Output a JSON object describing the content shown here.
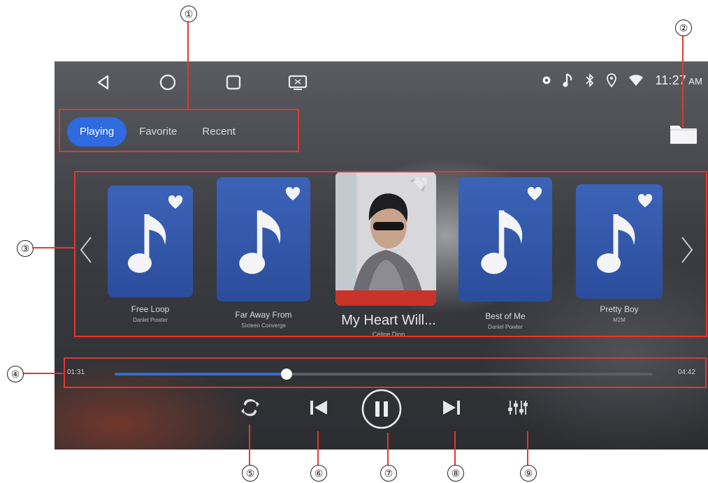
{
  "status_bar": {
    "nav_icons": [
      "back-icon",
      "home-icon",
      "recents-icon",
      "screen-icon"
    ],
    "status_icons": [
      "settings-dot-icon",
      "music-note-icon",
      "bluetooth-icon",
      "location-icon",
      "wifi-icon"
    ],
    "time": "11:27",
    "ampm": "AM"
  },
  "tabs": [
    {
      "label": "Playing",
      "active": true
    },
    {
      "label": "Favorite",
      "active": false
    },
    {
      "label": "Recent",
      "active": false
    }
  ],
  "carousel": {
    "cards": [
      {
        "title": "Free Loop",
        "artist": "Daniel Powter"
      },
      {
        "title": "Far Away From",
        "artist": "Sixteen Converge"
      },
      {
        "title": "Best of Me",
        "artist": "Daniel Powter"
      },
      {
        "title": "Pretty Boy",
        "artist": "M2M"
      }
    ],
    "current": {
      "title": "My Heart Will...",
      "artist": "Céline Dion"
    }
  },
  "progress": {
    "elapsed": "01:31",
    "total": "04:42",
    "fraction": 0.32
  },
  "controls": [
    "repeat-icon",
    "previous-icon",
    "pause-icon",
    "next-icon",
    "equalizer-icon"
  ],
  "callouts": [
    "①",
    "②",
    "③",
    "④",
    "⑤",
    "⑥",
    "⑦",
    "⑧",
    "⑨"
  ],
  "colors": {
    "accent": "#2f6ae0",
    "annotation": "#e0392b"
  }
}
